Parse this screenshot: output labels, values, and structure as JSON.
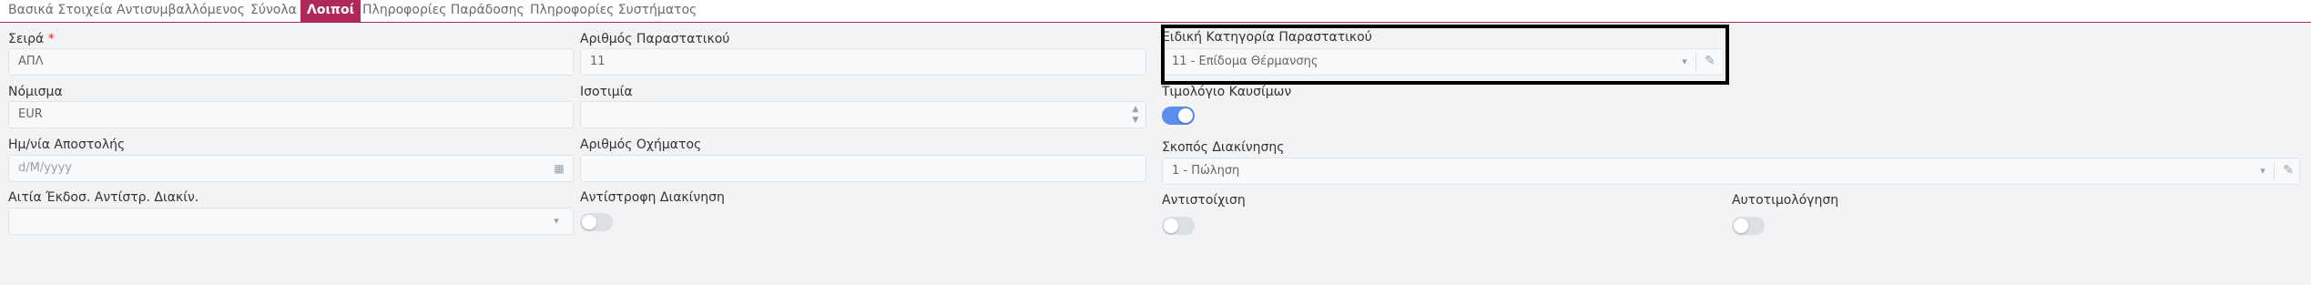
{
  "tabs": [
    {
      "label": "Βασικά Στοιχεία",
      "active": false
    },
    {
      "label": "Αντισυμβαλλόμενος",
      "active": false
    },
    {
      "label": "Σύνολα",
      "active": false
    },
    {
      "label": "Λοιποί",
      "active": true
    },
    {
      "label": "Πληροφορίες Παράδοσης",
      "active": false
    },
    {
      "label": "Πληροφορίες Συστήματος",
      "active": false
    }
  ],
  "form": {
    "series": {
      "label": "Σειρά",
      "required_mark": "*",
      "value": "ΑΠΛ"
    },
    "doc_number": {
      "label": "Αριθμός Παραστατικού",
      "value": "11"
    },
    "special_category": {
      "label": "Ειδική Κατηγορία Παραστατικού",
      "value": "11 - Επίδομα Θέρμανσης"
    },
    "currency": {
      "label": "Νόμισμα",
      "value": "EUR"
    },
    "exchange_rate": {
      "label": "Ισοτιμία",
      "value": ""
    },
    "fuel_invoice": {
      "label": "Τιμολόγιο Καυσίμων",
      "checked": true
    },
    "ship_date": {
      "label": "Ημ/νία Αποστολής",
      "placeholder": "d/M/yyyy"
    },
    "vehicle_number": {
      "label": "Αριθμός Οχήματος",
      "value": ""
    },
    "movement_purpose": {
      "label": "Σκοπός Διακίνησης",
      "value": "1 - Πώληση"
    },
    "reverse_reason": {
      "label": "Αιτία Έκδοσ. Αντίστρ. Διακίν.",
      "value": ""
    },
    "reverse_movement": {
      "label": "Αντίστροφη Διακίνηση",
      "checked": false
    },
    "correlation": {
      "label": "Αντιστοίχιση",
      "checked": false
    },
    "self_billing": {
      "label": "Αυτοτιμολόγηση",
      "checked": false
    }
  },
  "icons": {
    "dropdown": "▾",
    "edit": "✎",
    "spin_up": "▲",
    "spin_down": "▼",
    "calendar": "▦"
  },
  "colors": {
    "accent": "#b0285a",
    "toggle_on": "#5b8def",
    "required": "#d62828"
  }
}
